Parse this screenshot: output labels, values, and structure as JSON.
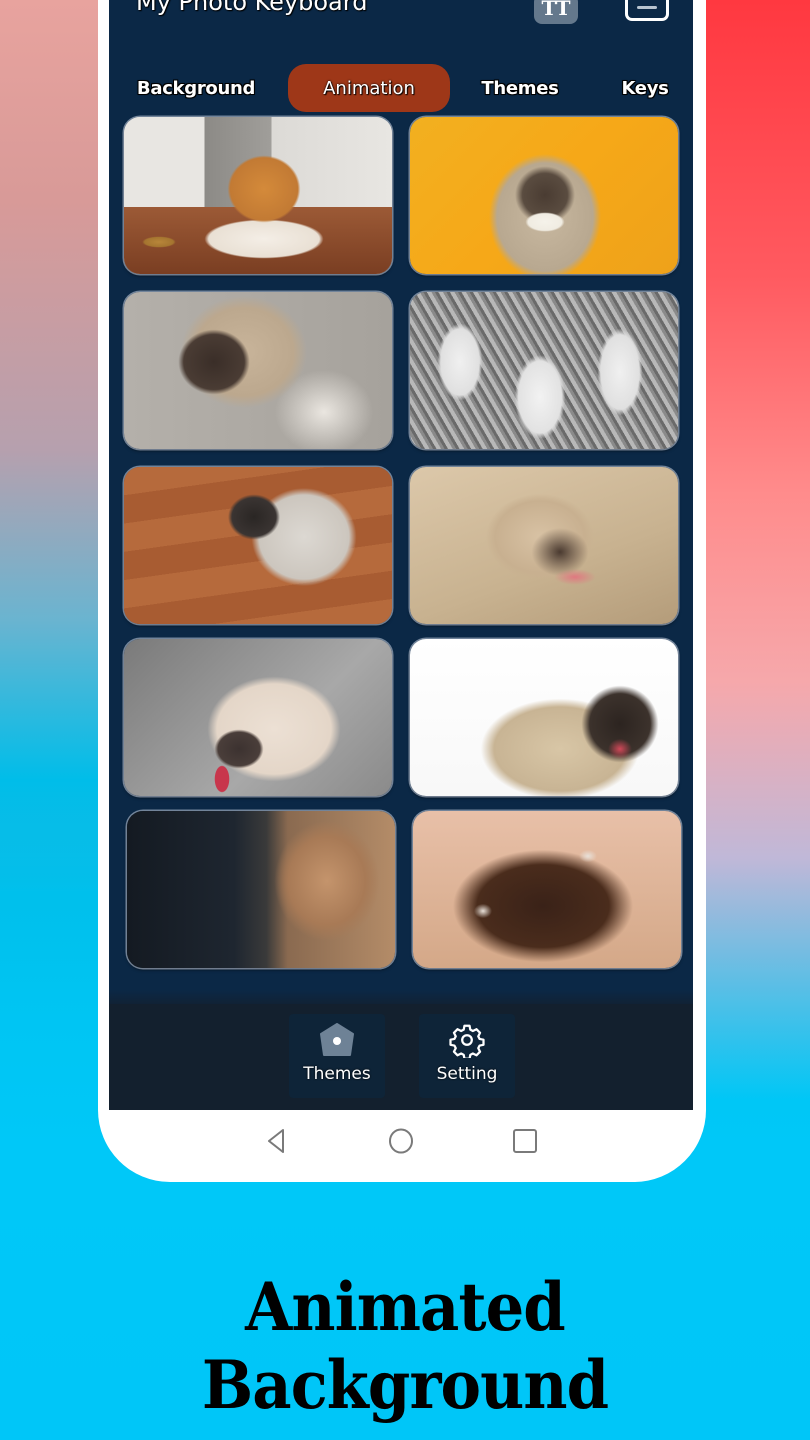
{
  "app": {
    "title": "My Photo Keyboard",
    "font_button_glyph": "TT",
    "keyboard_button_icon": "keyboard-icon"
  },
  "tabs": [
    {
      "label": "Background",
      "active": false
    },
    {
      "label": "Animation",
      "active": true
    },
    {
      "label": "Themes",
      "active": false
    },
    {
      "label": "Keys",
      "active": false
    }
  ],
  "animations": [
    {
      "description": "Fluffy Pomeranian puppy lying on a wooden kitchen floor"
    },
    {
      "description": "Smiling pug on a yellow background"
    },
    {
      "description": "Pug with wide eyes on a grey floor"
    },
    {
      "description": "Three pugs sitting on a patterned rug (black and white)"
    },
    {
      "description": "Pug standing on a wooden floor"
    },
    {
      "description": "Pug with tongue out on a light wood floor"
    },
    {
      "description": "Cartoon pug with tongue out"
    },
    {
      "description": "Pug close-up on white background with tongue out"
    },
    {
      "description": "Two pugs, black and fawn, lying together"
    },
    {
      "description": "Dark pug puppy face close-up looking up"
    }
  ],
  "bottom_nav": [
    {
      "label": "Themes",
      "icon": "themes-pentagon-icon"
    },
    {
      "label": "Setting",
      "icon": "gear-icon"
    }
  ],
  "system_nav": {
    "back": "back-icon",
    "home": "home-icon",
    "recents": "recents-icon"
  },
  "caption": "Animated Background",
  "colors": {
    "screen_bg": "#0b2846",
    "active_tab": "#9e3718",
    "bottom_nav_bg": "#13202e",
    "caption_bg": "#00c6f8"
  }
}
